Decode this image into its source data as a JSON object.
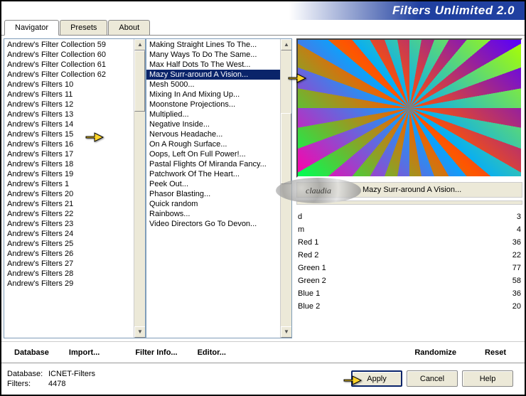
{
  "title": "Filters Unlimited 2.0",
  "tabs": [
    {
      "label": "Navigator",
      "active": true
    },
    {
      "label": "Presets",
      "active": false
    },
    {
      "label": "About",
      "active": false
    }
  ],
  "collections": [
    "Andrew's Filter Collection 59",
    "Andrew's Filter Collection 60",
    "Andrew's Filter Collection 61",
    "Andrew's Filter Collection 62",
    "Andrew's Filters 10",
    "Andrew's Filters 11",
    "Andrew's Filters 12",
    "Andrew's Filters 13",
    "Andrew's Filters 14",
    "Andrew's Filters 15",
    "Andrew's Filters 16",
    "Andrew's Filters 17",
    "Andrew's Filters 18",
    "Andrew's Filters 19",
    "Andrew's Filters 1",
    "Andrew's Filters 20",
    "Andrew's Filters 21",
    "Andrew's Filters 22",
    "Andrew's Filters 23",
    "Andrew's Filters 24",
    "Andrew's Filters 25",
    "Andrew's Filters 26",
    "Andrew's Filters 27",
    "Andrew's Filters 28",
    "Andrew's Filters 29"
  ],
  "collection_selected": "Andrew's Filters 15",
  "filters": [
    "Making Straight Lines To The...",
    "Many Ways To Do The Same...",
    "Max Half Dots To The West...",
    "Mazy Surr-around A Vision...",
    "Mesh 5000...",
    "Mixing In And Mixing Up...",
    "Moonstone Projections...",
    "Multiplied...",
    "Negative Inside...",
    "Nervous Headache...",
    "On A Rough Surface...",
    "Oops, Left On Full Power!...",
    "Pastal Flights Of Miranda Fancy...",
    "Patchwork Of The Heart...",
    "Peek Out...",
    "Phasor Blasting...",
    "Quick random",
    "Rainbows...",
    "Video Directors Go To Devon..."
  ],
  "filter_selected": "Mazy Surr-around A Vision...",
  "selected_filter_label": "Mazy Surr-around A Vision...",
  "params": [
    {
      "label": "d",
      "value": 3
    },
    {
      "label": "m",
      "value": 4
    },
    {
      "label": "Red 1",
      "value": 36
    },
    {
      "label": "Red 2",
      "value": 22
    },
    {
      "label": "Green 1",
      "value": 77
    },
    {
      "label": "Green 2",
      "value": 58
    },
    {
      "label": "Blue 1",
      "value": 36
    },
    {
      "label": "Blue 2",
      "value": 20
    }
  ],
  "toolbar": {
    "database": "Database",
    "import": "Import...",
    "filter_info": "Filter Info...",
    "editor": "Editor...",
    "randomize": "Randomize",
    "reset": "Reset"
  },
  "footer": {
    "db_label": "Database:",
    "db_value": "ICNET-Filters",
    "filters_label": "Filters:",
    "filters_value": "4478",
    "apply": "Apply",
    "cancel": "Cancel",
    "help": "Help"
  },
  "watermark": "claudia"
}
